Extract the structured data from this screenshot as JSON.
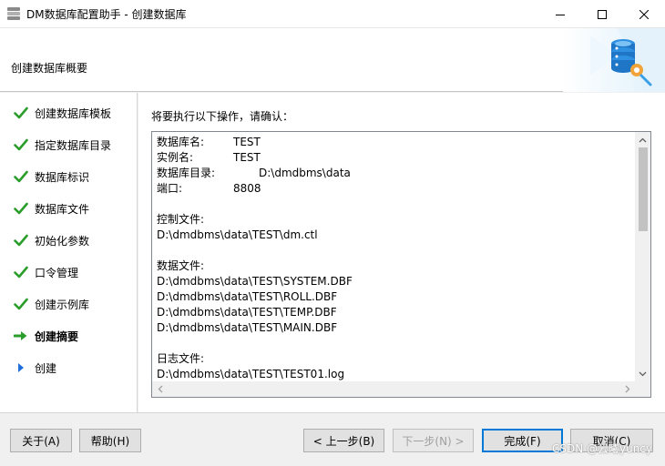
{
  "window": {
    "title": "DM数据库配置助手 - 创建数据库"
  },
  "header": {
    "title": "创建数据库概要"
  },
  "nav": {
    "items": [
      {
        "label": "创建数据库模板",
        "state": "done"
      },
      {
        "label": "指定数据库目录",
        "state": "done"
      },
      {
        "label": "数据库标识",
        "state": "done"
      },
      {
        "label": "数据库文件",
        "state": "done"
      },
      {
        "label": "初始化参数",
        "state": "done"
      },
      {
        "label": "口令管理",
        "state": "done"
      },
      {
        "label": "创建示例库",
        "state": "done"
      },
      {
        "label": "创建摘要",
        "state": "current"
      },
      {
        "label": "创建",
        "state": "pending"
      }
    ]
  },
  "main": {
    "prompt": "将要执行以下操作，请确认：",
    "summary": {
      "db_name_label": "数据库名:",
      "db_name_value": "TEST",
      "instance_label": "实例名:",
      "instance_value": "TEST",
      "dir_label": "数据库目录:",
      "dir_value": "D:\\dmdbms\\data",
      "port_label": "端口:",
      "port_value": "8808",
      "control_heading": "控制文件:",
      "control_files": [
        "D:\\dmdbms\\data\\TEST\\dm.ctl"
      ],
      "data_heading": "数据文件:",
      "data_files": [
        "D:\\dmdbms\\data\\TEST\\SYSTEM.DBF",
        "D:\\dmdbms\\data\\TEST\\ROLL.DBF",
        "D:\\dmdbms\\data\\TEST\\TEMP.DBF",
        "D:\\dmdbms\\data\\TEST\\MAIN.DBF"
      ],
      "log_heading": "日志文件:",
      "log_files": [
        "D:\\dmdbms\\data\\TEST\\TEST01.log"
      ]
    }
  },
  "footer": {
    "about": "关于(A)",
    "help": "帮助(H)",
    "back": "< 上一步(B)",
    "next": "下一步(N) >",
    "finish": "完成(F)",
    "cancel": "取消(C)"
  },
  "watermark": "CSDN @云曦yuncy",
  "colors": {
    "check": "#2a9d2a",
    "current_arrow": "#2a9d2a",
    "pending_triangle": "#1e6fd9",
    "default_button_border": "#0078d7"
  }
}
